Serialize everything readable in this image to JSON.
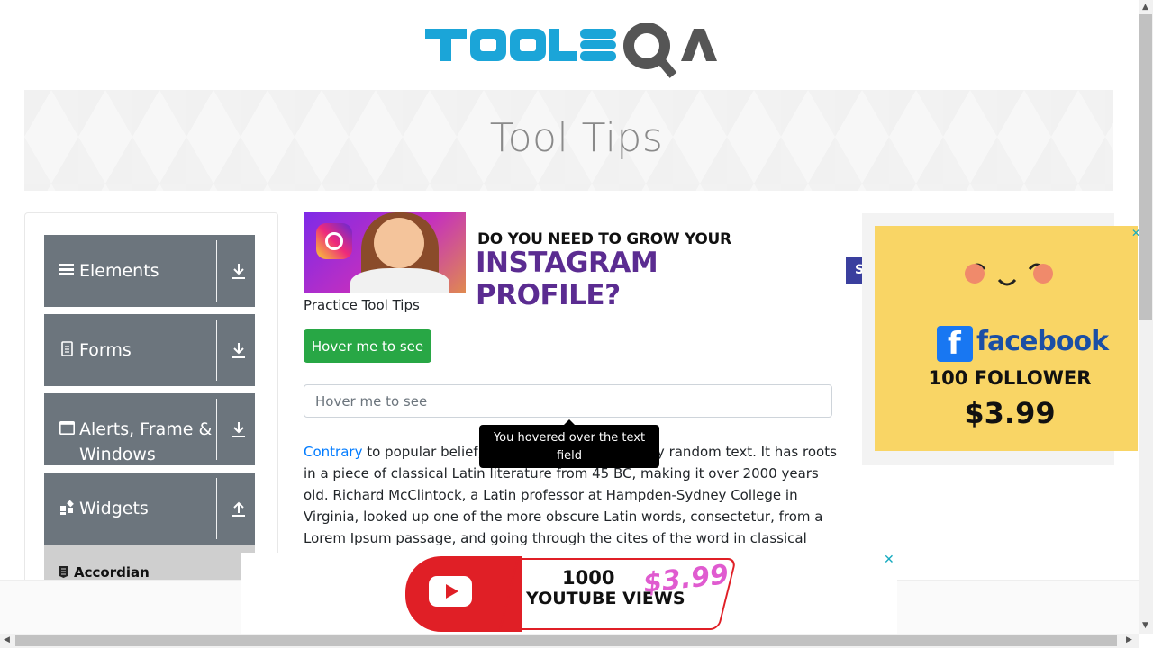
{
  "header": {
    "logo_text": "TOOLSQA"
  },
  "banner": {
    "title": "Tool Tips"
  },
  "sidebar": {
    "groups": [
      {
        "label": "Elements",
        "icon": "hamburger-icon",
        "arrow": "download-icon"
      },
      {
        "label": "Forms",
        "icon": "document-icon",
        "arrow": "download-icon"
      },
      {
        "label": "Alerts, Frame & Windows",
        "icon": "window-icon",
        "arrow": "download-icon"
      },
      {
        "label": "Widgets",
        "icon": "widgets-icon",
        "arrow": "upload-icon"
      }
    ],
    "sub_items": [
      {
        "label": "Accordian",
        "icon": "html5-icon"
      }
    ]
  },
  "ad_top": {
    "line1": "DO YOU NEED TO GROW YOUR",
    "line2": "INSTAGRAM PROFILE?"
  },
  "main": {
    "practice_label": "Practice Tool Tips",
    "button_label": "Hover me to see",
    "input_placeholder": "Hover me to see",
    "tooltip": "You hovered over the text field",
    "para_link": "Contrary",
    "para_text": " to popular belief, Lorem Ipsum is not simply random text. It has roots in a piece of classical Latin literature from 45 BC, making it over 2000 years old. Richard McClintock, a Latin professor at Hampden-Sydney College in Virginia, looked up one of the more obscure Latin words, consectetur, from a Lorem Ipsum passage, and going through the cites of the word in classical literature, discovered the",
    "side_badge": "S"
  },
  "ad_right": {
    "brand": "facebook",
    "line1": "100 FOLLOWER",
    "price": "$3.99",
    "close": "✕"
  },
  "ad_bottom": {
    "line1": "1000",
    "line2": "YOUTUBE VIEWS",
    "price": "$3.99",
    "close": "✕"
  },
  "colors": {
    "accent_blue": "#1ba5d8",
    "sidebar_bg": "#6c757d",
    "button_green": "#28a745",
    "link": "#007bff"
  }
}
